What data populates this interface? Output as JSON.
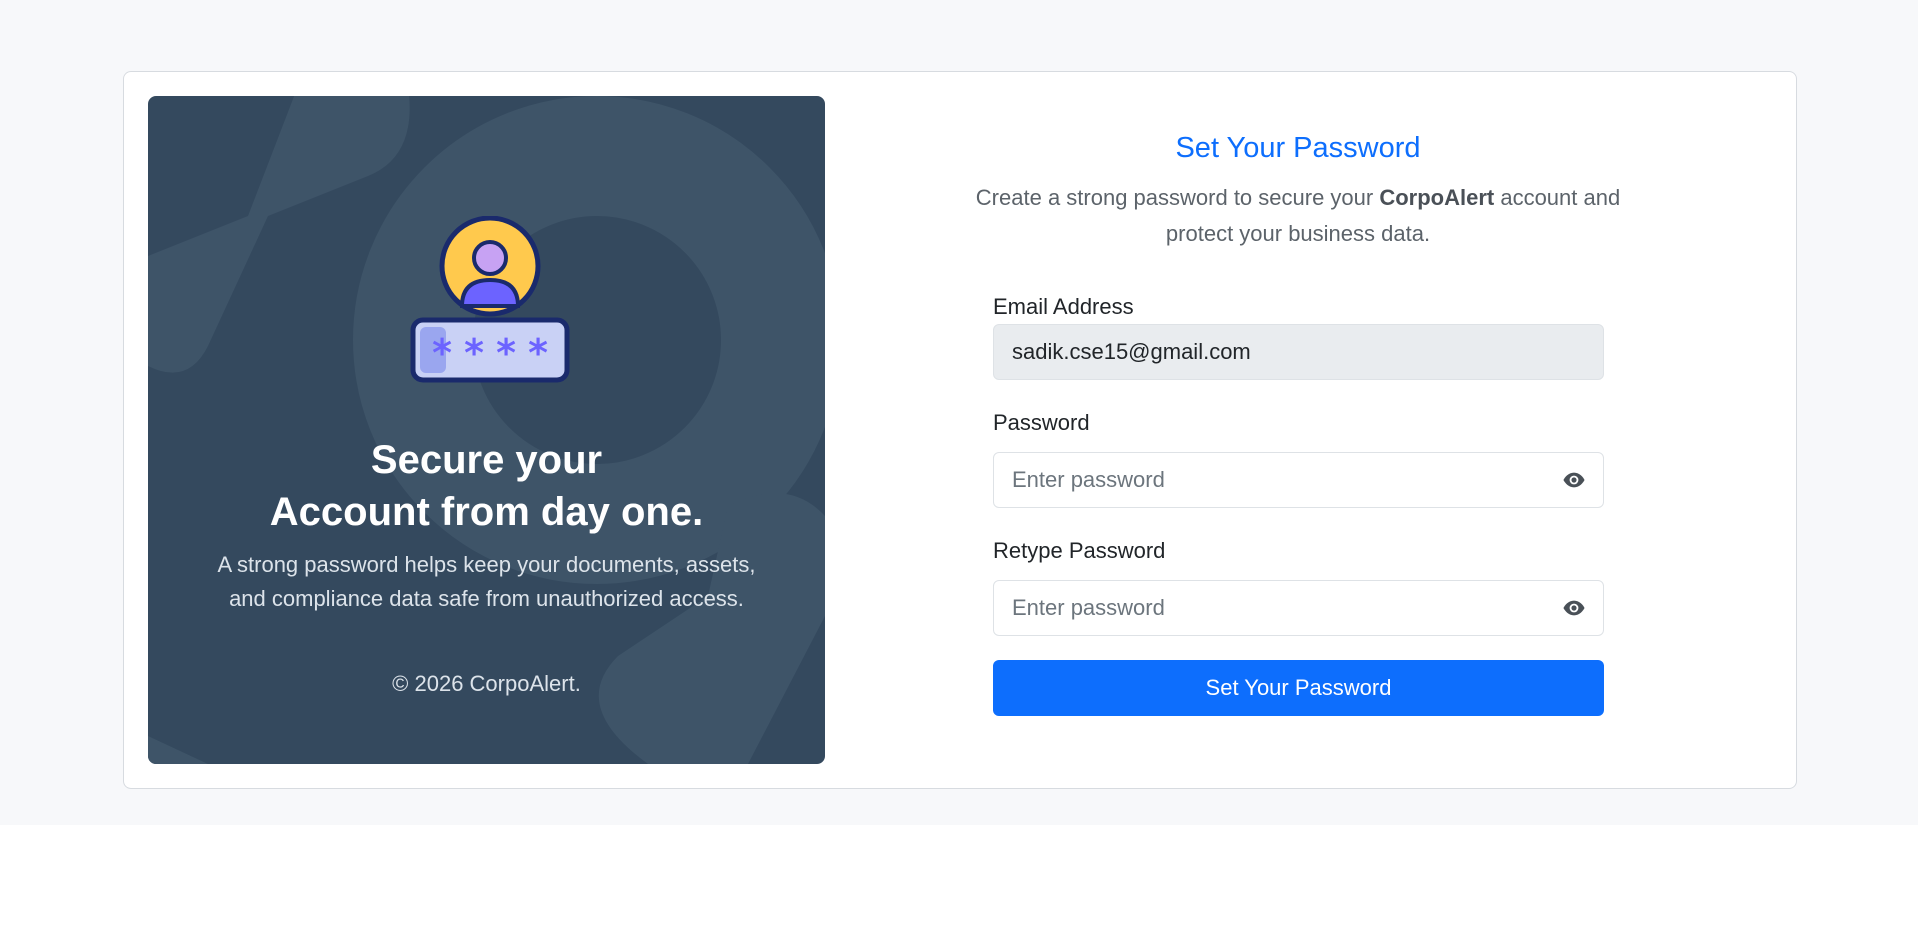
{
  "hero": {
    "title_line1": "Secure your",
    "title_line2": "Account from day one.",
    "description": "A strong password helps keep your documents, assets, and compliance data safe from unauthorized access.",
    "footer": "© 2026 CorpoAlert.",
    "illustration_icon": "user-password-icon"
  },
  "form": {
    "title": "Set Your Password",
    "subtitle_before": "Create a strong password to secure your ",
    "subtitle_brand": "CorpoAlert",
    "subtitle_after": " account and protect your business data.",
    "email": {
      "label": "Email Address",
      "value": "sadik.cse15@gmail.com"
    },
    "password": {
      "label": "Password",
      "placeholder": "Enter password",
      "toggle_icon": "eye-icon"
    },
    "retype_password": {
      "label": "Retype Password",
      "placeholder": "Enter password",
      "toggle_icon": "eye-icon"
    },
    "submit_label": "Set Your Password"
  },
  "colors": {
    "accent": "#0d6efd",
    "hero_bg": "#34495e",
    "page_bg": "#f7f8fa",
    "readonly_bg": "#e9ecef"
  }
}
